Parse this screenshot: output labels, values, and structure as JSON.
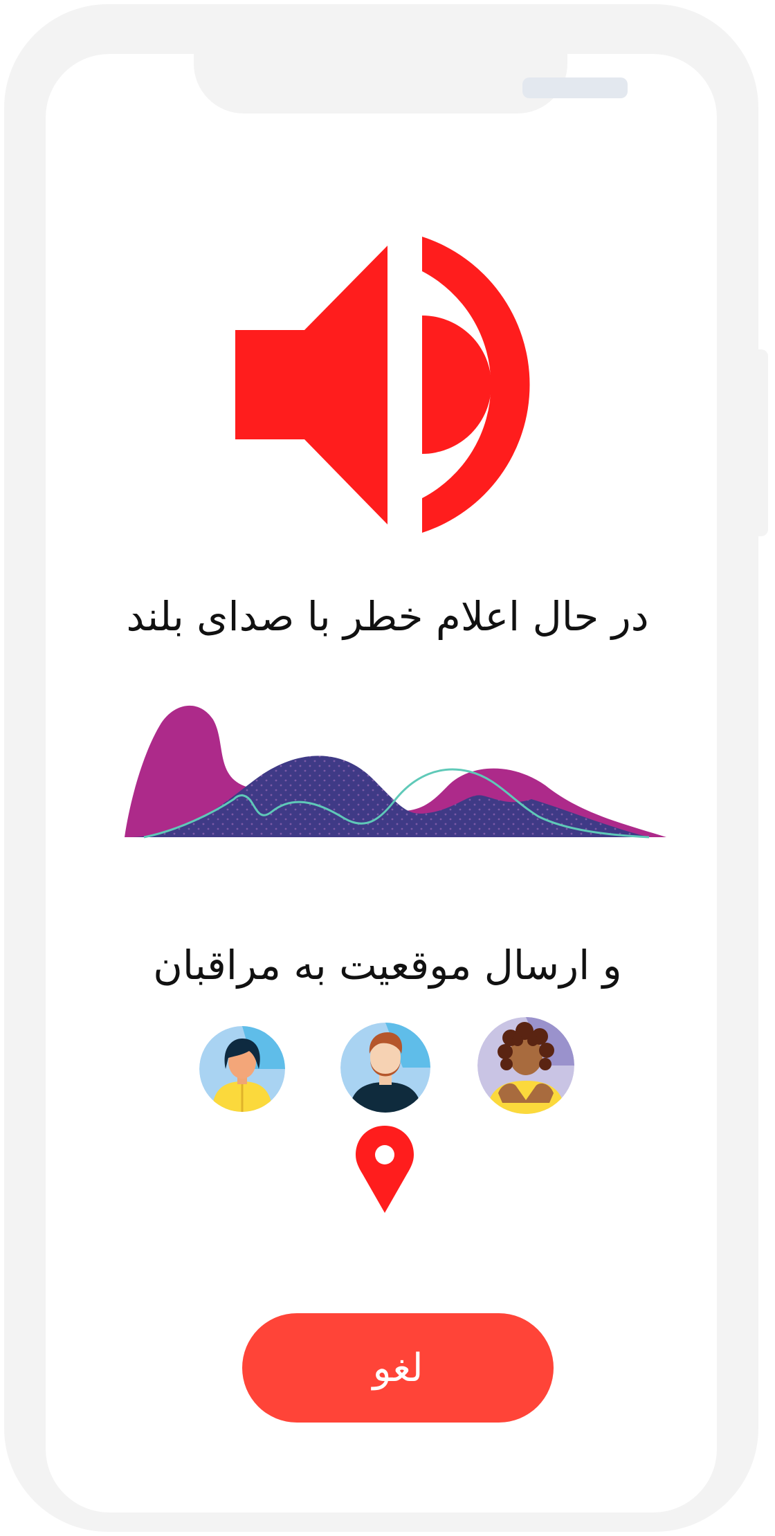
{
  "alert": {
    "icon": "speaker-volume-icon",
    "message": "در حال اعلام خطر با صدای بلند",
    "location_message": "و ارسال موقعیت به مراقبان"
  },
  "sound_wave": {
    "icon": "audio-waveform-icon"
  },
  "caregivers": [
    {
      "icon": "avatar-woman-short-hair-icon"
    },
    {
      "icon": "avatar-man-beard-icon"
    },
    {
      "icon": "avatar-woman-curly-hair-icon"
    }
  ],
  "location": {
    "icon": "location-pin-icon"
  },
  "actions": {
    "cancel_label": "لغو"
  },
  "colors": {
    "accent": "#ff1d1d",
    "button": "#ff4438",
    "wave_magenta": "#ad2a8a",
    "wave_indigo": "#3f3a86",
    "wave_line": "#5fc9b8"
  }
}
